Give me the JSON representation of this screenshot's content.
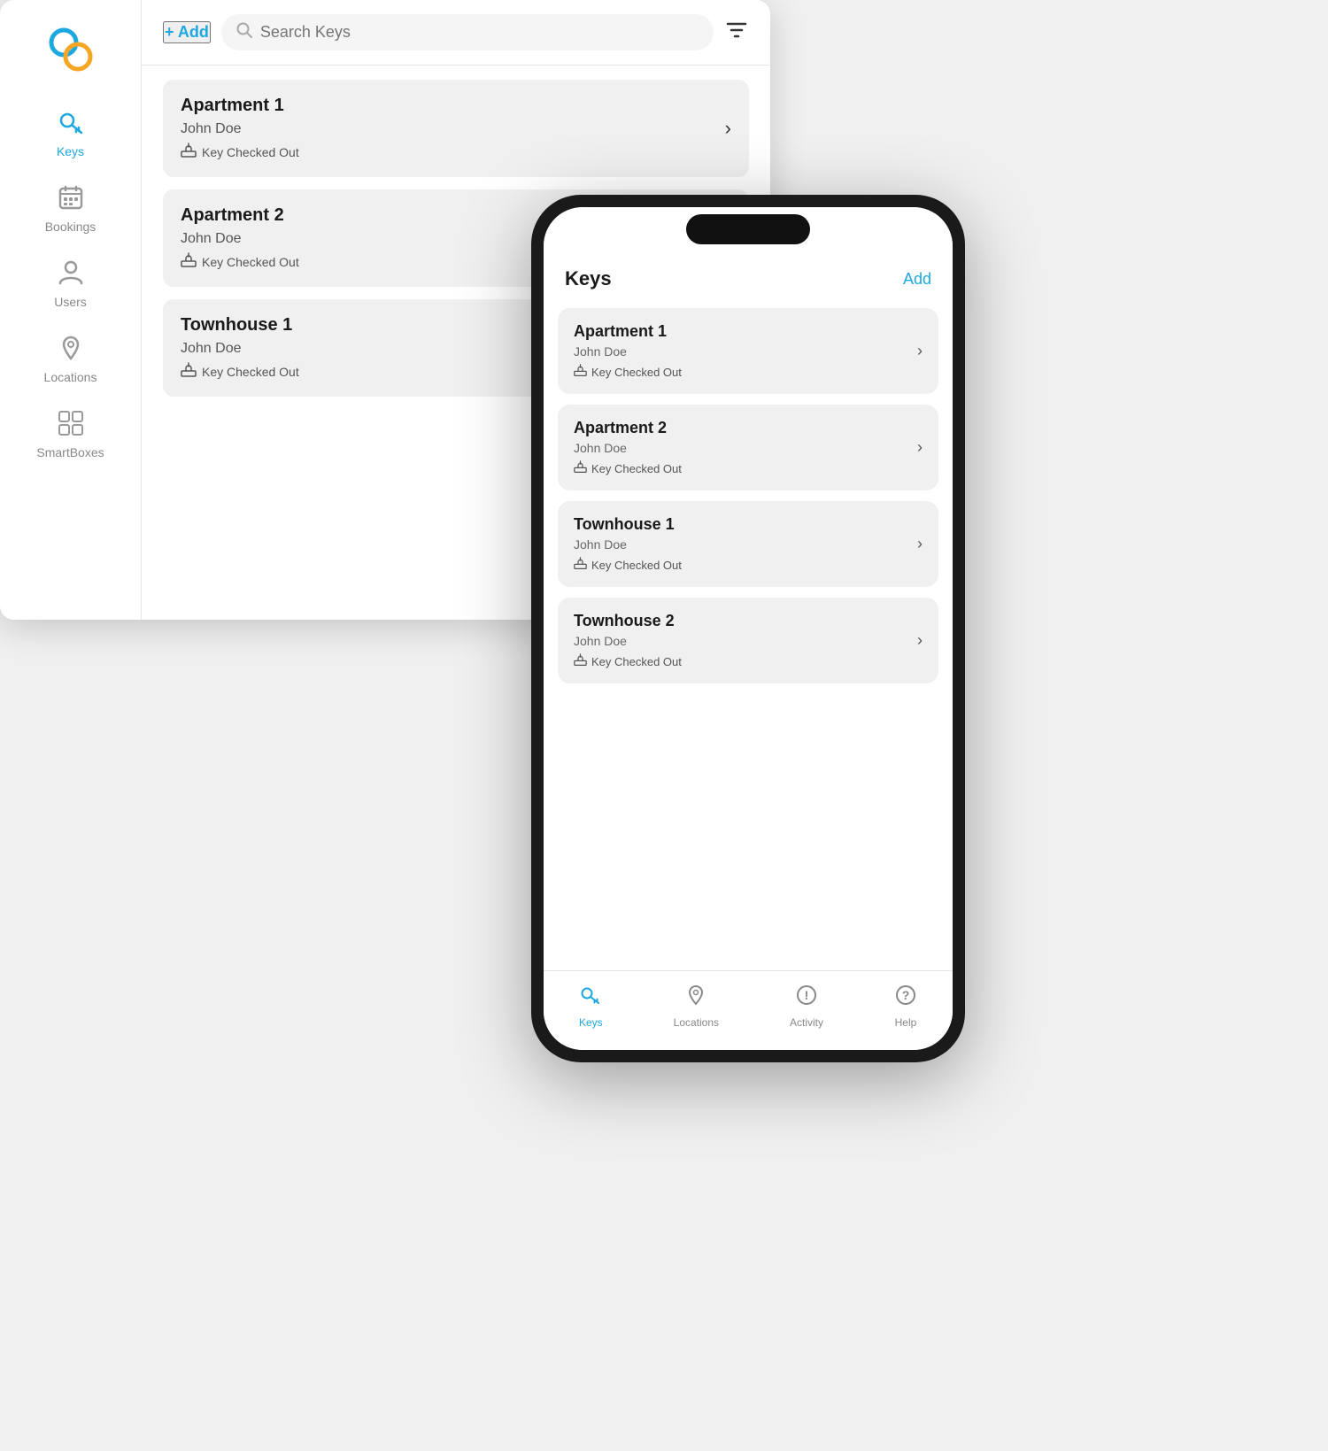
{
  "desktop": {
    "toolbar": {
      "add_label": "+ Add",
      "search_placeholder": "Search Keys",
      "filter_icon": "filter"
    },
    "keys": [
      {
        "title": "Apartment 1",
        "name": "John Doe",
        "status": "Key Checked Out"
      },
      {
        "title": "Apartment 2",
        "name": "John Doe",
        "status": "Key Checked Out"
      },
      {
        "title": "Townhouse 1",
        "name": "John Doe",
        "status": "Key Checked Out"
      }
    ],
    "sidebar": {
      "items": [
        {
          "label": "Keys",
          "active": true
        },
        {
          "label": "Bookings",
          "active": false
        },
        {
          "label": "Users",
          "active": false
        },
        {
          "label": "Locations",
          "active": false
        },
        {
          "label": "SmartBoxes",
          "active": false
        }
      ]
    }
  },
  "phone": {
    "header": {
      "title": "Keys",
      "add_label": "Add"
    },
    "keys": [
      {
        "title": "Apartment 1",
        "name": "John Doe",
        "status": "Key Checked Out"
      },
      {
        "title": "Apartment 2",
        "name": "John Doe",
        "status": "Key Checked Out"
      },
      {
        "title": "Townhouse 1",
        "name": "John Doe",
        "status": "Key Checked Out"
      },
      {
        "title": "Townhouse 2",
        "name": "John Doe",
        "status": "Key Checked Out"
      }
    ],
    "tabs": [
      {
        "label": "Keys",
        "active": true,
        "icon": "key"
      },
      {
        "label": "Locations",
        "active": false,
        "icon": "location"
      },
      {
        "label": "Activity",
        "active": false,
        "icon": "activity"
      },
      {
        "label": "Help",
        "active": false,
        "icon": "help"
      }
    ]
  }
}
